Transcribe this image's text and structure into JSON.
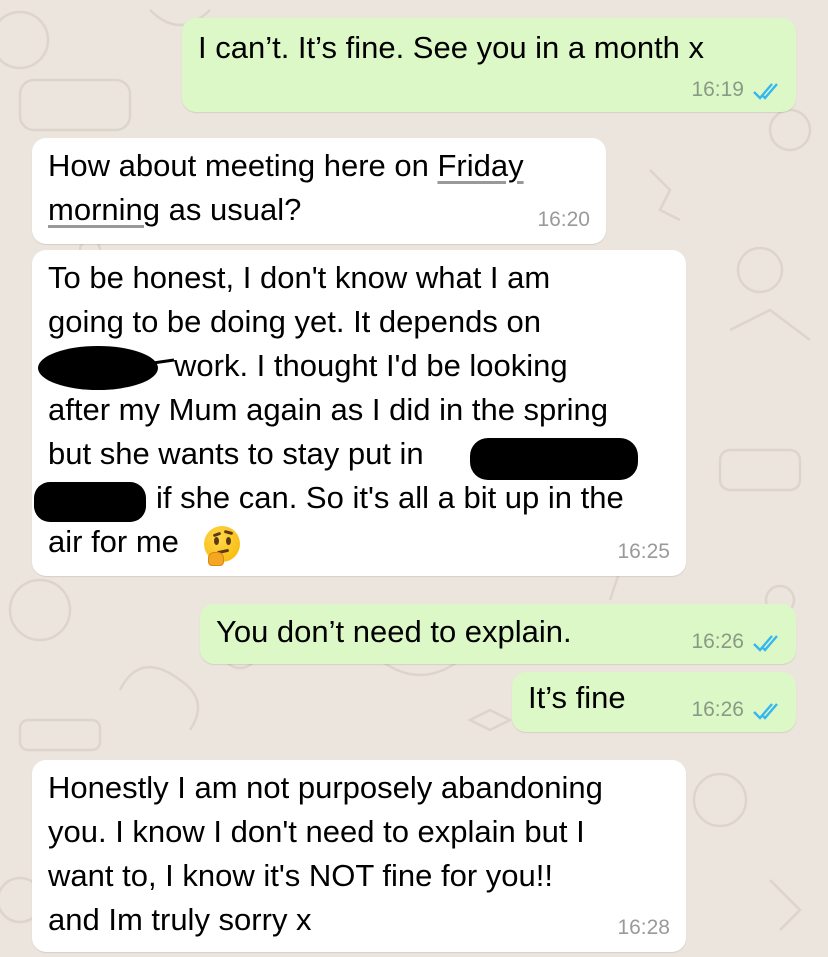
{
  "colors": {
    "outgoing_bubble": "#dcf8c6",
    "incoming_bubble": "#ffffff",
    "background": "#ece5dd",
    "read_ticks": "#34b7f1"
  },
  "messages": [
    {
      "direction": "outgoing",
      "text": "I can’t. It’s fine. See you in a month x",
      "time": "16:19",
      "status": "read"
    },
    {
      "direction": "incoming",
      "lines": [
        "How about meeting here on ",
        "Friday",
        "morning",
        " as usual?"
      ],
      "time": "16:20"
    },
    {
      "direction": "incoming",
      "lines": [
        "To be honest, I don't know what I am",
        "going to be doing yet. It depends on",
        "work. I thought I'd be looking",
        "after my Mum again as I did in the spring",
        "but she wants to stay put in",
        "if she can. So it's all a bit up in the",
        "air for me"
      ],
      "time": "16:25",
      "emoji": "thinking-face"
    },
    {
      "direction": "outgoing",
      "text": "You don’t need to explain.",
      "time": "16:26",
      "status": "read"
    },
    {
      "direction": "outgoing",
      "text": "It’s fine",
      "time": "16:26",
      "status": "read"
    },
    {
      "direction": "incoming",
      "lines": [
        "Honestly I am not purposely abandoning",
        "you. I know I don't need to explain but I",
        "want to, I know it's NOT fine for you!!",
        "and Im truly sorry x"
      ],
      "time": "16:28"
    }
  ]
}
